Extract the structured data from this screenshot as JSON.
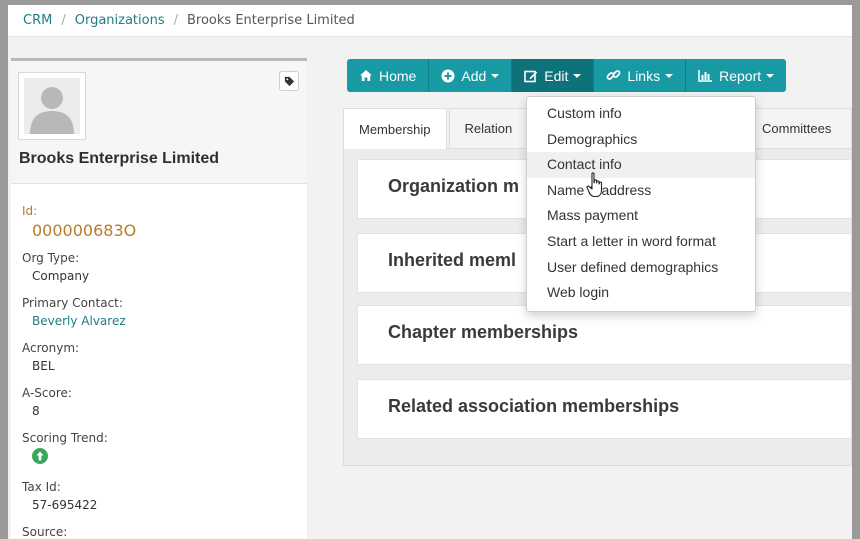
{
  "breadcrumb": {
    "items": [
      "CRM",
      "Organizations"
    ],
    "current": "Brooks Enterprise Limited"
  },
  "organization": {
    "name": "Brooks Enterprise Limited",
    "fields": {
      "id_label": "Id:",
      "id_value": "000000683O",
      "org_type_label": "Org Type:",
      "org_type_value": "Company",
      "primary_contact_label": "Primary Contact:",
      "primary_contact_value": "Beverly Alvarez",
      "acronym_label": "Acronym:",
      "acronym_value": "BEL",
      "ascore_label": "A-Score:",
      "ascore_value": "8",
      "scoring_trend_label": "Scoring Trend:",
      "scoring_trend_icon": "arrow-up-circle-icon",
      "tax_id_label": "Tax Id:",
      "tax_id_value": "57-695422",
      "source_label": "Source:"
    }
  },
  "toolbar": {
    "home": "Home",
    "add": "Add",
    "edit": "Edit",
    "links": "Links",
    "report": "Report"
  },
  "tabs": {
    "membership": "Membership",
    "relations": "Relation",
    "committees": "Committees"
  },
  "sections": {
    "organization": "Organization m",
    "inherited": "Inherited meml",
    "chapter": "Chapter memberships",
    "related": "Related association memberships"
  },
  "edit_menu": {
    "items": [
      "Custom info",
      "Demographics",
      "Contact info",
      "Name & address",
      "Mass payment",
      "Start a letter in word format",
      "User defined demographics",
      "Web login"
    ],
    "hovered": "Contact info"
  },
  "colors": {
    "toolbar": "#179aa3",
    "toolbar_active": "#0d727a",
    "link": "#1f7c86",
    "id_accent": "#b97b2a",
    "trend_icon": "#3ba55c"
  }
}
